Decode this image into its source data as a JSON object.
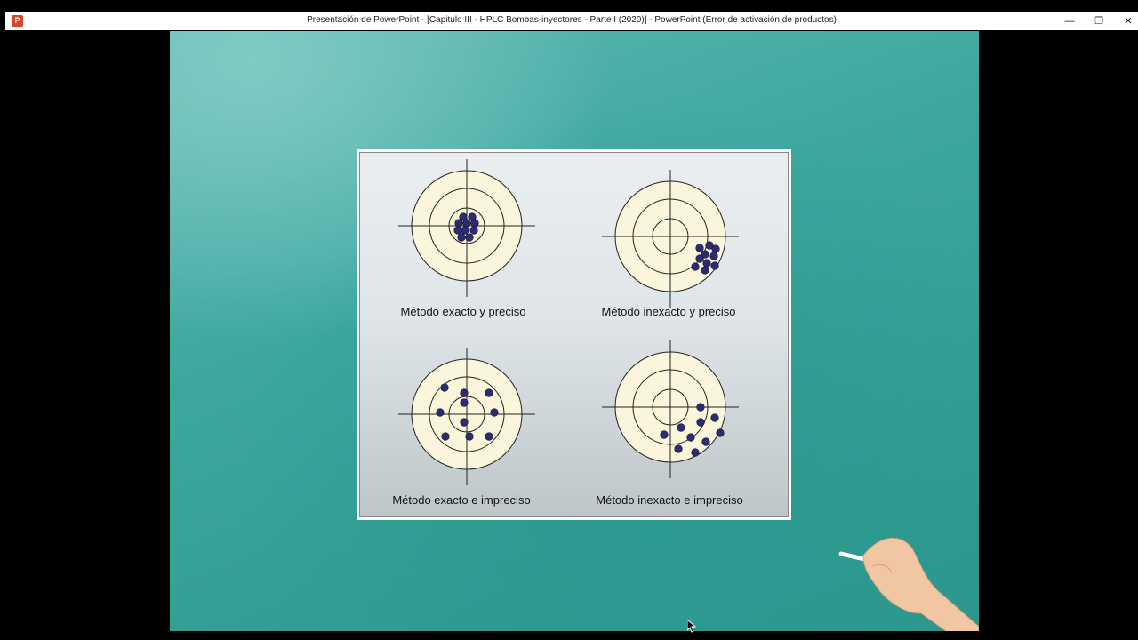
{
  "window": {
    "title": "Presentación de PowerPoint - [Capitulo III - HPLC Bombas-inyectores - Parte I (2020)] - PowerPoint (Error de activación de productos)",
    "app_icon": "powerpoint-icon",
    "app_icon_letter": "P",
    "minimize_glyph": "—",
    "restore_glyph": "❐",
    "close_glyph": "✕"
  },
  "slide": {
    "panels": [
      {
        "caption": "Método exacto y preciso"
      },
      {
        "caption": "Método inexacto y preciso"
      },
      {
        "caption": "Método exacto e impreciso"
      },
      {
        "caption": "Método inexacto e impreciso"
      }
    ]
  },
  "colors": {
    "target_fill": "#fbf5dc",
    "dot": "#2b2b7a",
    "accent": "#3da79e"
  }
}
